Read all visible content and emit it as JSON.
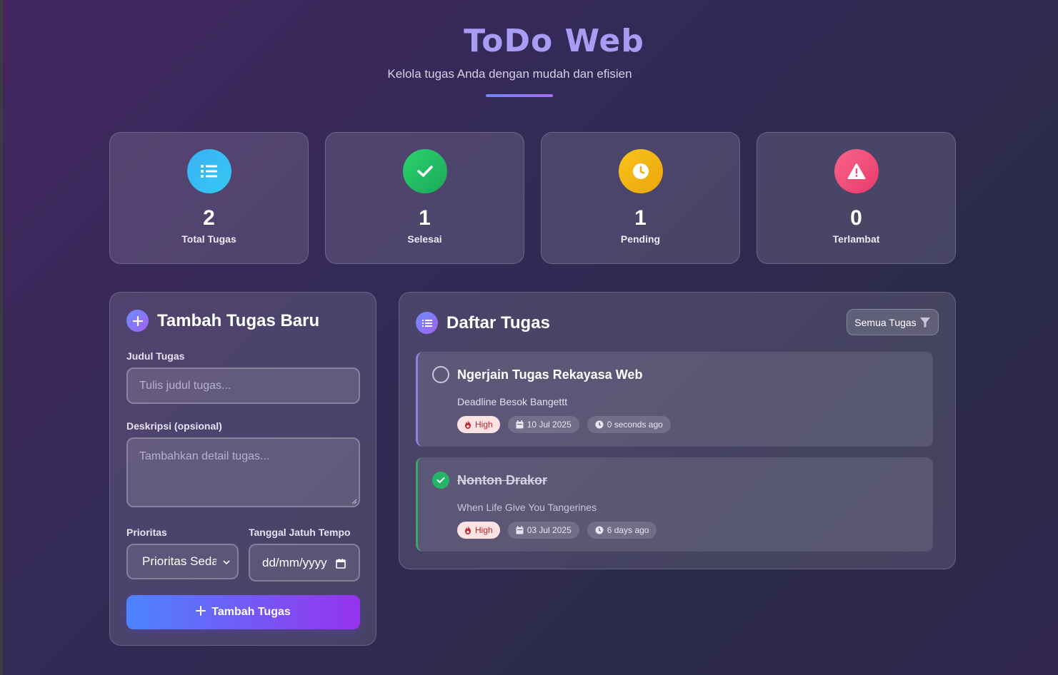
{
  "header": {
    "title": "ToDo Web",
    "subtitle": "Kelola tugas Anda dengan mudah dan efisien"
  },
  "stats": [
    {
      "value": "2",
      "label": "Total Tugas",
      "icon": "list-icon",
      "color": "#38bdf8"
    },
    {
      "value": "1",
      "label": "Selesai",
      "icon": "check-icon",
      "color": "#22c55e"
    },
    {
      "value": "1",
      "label": "Pending",
      "icon": "clock-icon",
      "color": "#eab308"
    },
    {
      "value": "0",
      "label": "Terlambat",
      "icon": "warning-icon",
      "color": "#f43f5e"
    }
  ],
  "form": {
    "title": "Tambah Tugas Baru",
    "title_label": "Judul Tugas",
    "title_placeholder": "Tulis judul tugas...",
    "desc_label": "Deskripsi (opsional)",
    "desc_placeholder": "Tambahkan detail tugas...",
    "priority_label": "Prioritas",
    "priority_value": "Prioritas Sedan",
    "date_label": "Tanggal Jatuh Tempo",
    "date_value": "dd/mm/yyyy",
    "submit_label": "Tambah Tugas"
  },
  "list": {
    "title": "Daftar Tugas",
    "filter_label": "Semua Tugas",
    "tasks": [
      {
        "title": "Ngerjain Tugas Rekayasa Web",
        "description": "Deadline Besok Bangettt",
        "priority": "High",
        "date": "10 Jul 2025",
        "created": "0 seconds ago",
        "done": false
      },
      {
        "title": "Nonton Drakor",
        "description": "When Life Give You Tangerines",
        "priority": "High",
        "date": "03 Jul 2025",
        "created": "6 days ago",
        "done": true
      }
    ]
  },
  "colors": {
    "accent_start": "#4c84ff",
    "accent_end": "#9633ec",
    "title": "#a99cf5"
  }
}
